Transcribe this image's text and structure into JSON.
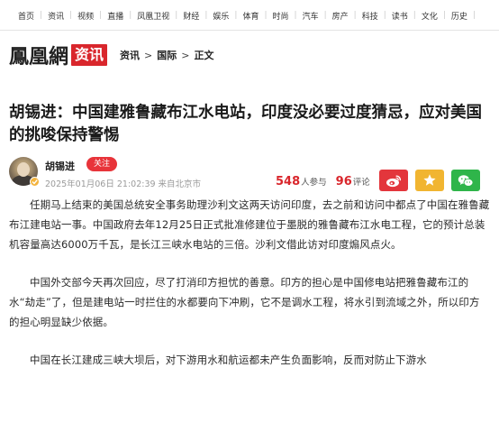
{
  "topnav": {
    "items": [
      "首页",
      "资讯",
      "视频",
      "直播",
      "凤凰卫视",
      "财经",
      "娱乐",
      "体育",
      "时尚",
      "汽车",
      "房产",
      "科技",
      "读书",
      "文化",
      "历史"
    ]
  },
  "logo": {
    "main": "鳳凰網",
    "badge": "资讯"
  },
  "breadcrumb": {
    "items": [
      "资讯",
      "国际",
      "正文"
    ],
    "separator": ">"
  },
  "article": {
    "title": "胡锡进：中国建雅鲁藏布江水电站，印度没必要过度猜忌，应对美国的挑唆保持警惕",
    "author": "胡锡进",
    "follow_label": "关注",
    "meta": "2025年01月06日 21:02:39 来自北京市",
    "participants_count": "548",
    "participants_label": "人参与",
    "comments_count": "96",
    "comments_label": "评论",
    "paragraphs": [
      "任期马上结束的美国总统安全事务助理沙利文这两天访问印度，去之前和访问中都点了中国在雅鲁藏布江建电站一事。中国政府去年12月25日正式批准修建位于墨脱的雅鲁藏布江水电工程，它的预计总装机容量高达6000万千瓦，是长江三峡水电站的三倍。沙利文借此访对印度煽风点火。",
      "中国外交部今天再次回应，尽了打消印方担忧的善意。印方的担心是中国修电站把雅鲁藏布江的水“劫走”了，但是建电站一时拦住的水都要向下冲刷，它不是调水工程，将水引到流域之外，所以印方的担心明显缺少依据。",
      "中国在长江建成三峡大坝后，对下游用水和航运都未产生负面影响，反而对防止下游水"
    ]
  },
  "share": {
    "icons": [
      "weibo-icon",
      "favorite-star-icon",
      "wechat-icon"
    ],
    "colors": {
      "weibo": "#e3363c",
      "star": "#f1b531",
      "wechat": "#2fb54a"
    }
  },
  "colors": {
    "brand_red": "#d9262c",
    "follow": "#e8343a",
    "meta_gray": "#9a9a9a"
  }
}
